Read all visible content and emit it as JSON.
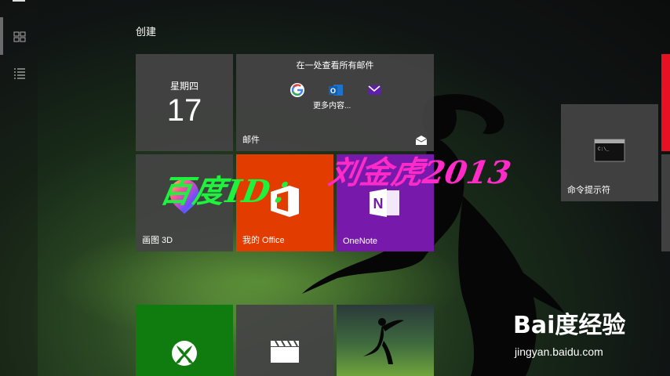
{
  "group": {
    "title": "创建"
  },
  "calendar": {
    "weekday": "星期四",
    "day": "17"
  },
  "mail": {
    "headline": "在一处查看所有邮件",
    "more": "更多内容...",
    "label": "邮件"
  },
  "tiles": {
    "paint3d": "画图 3D",
    "office": "我的 Office",
    "onenote": "OneNote",
    "cmd": "命令提示符"
  },
  "watermark": {
    "part1": "百度ID：",
    "part2": "刘金虎2013"
  },
  "branding": {
    "logo": "Bai度经验",
    "url": "jingyan.baidu.com"
  },
  "colors": {
    "office": "#e23c00",
    "onenote": "#7719aa",
    "xbox": "#107c10",
    "red_tile": "#e81123",
    "tile_gray": "#444444"
  }
}
